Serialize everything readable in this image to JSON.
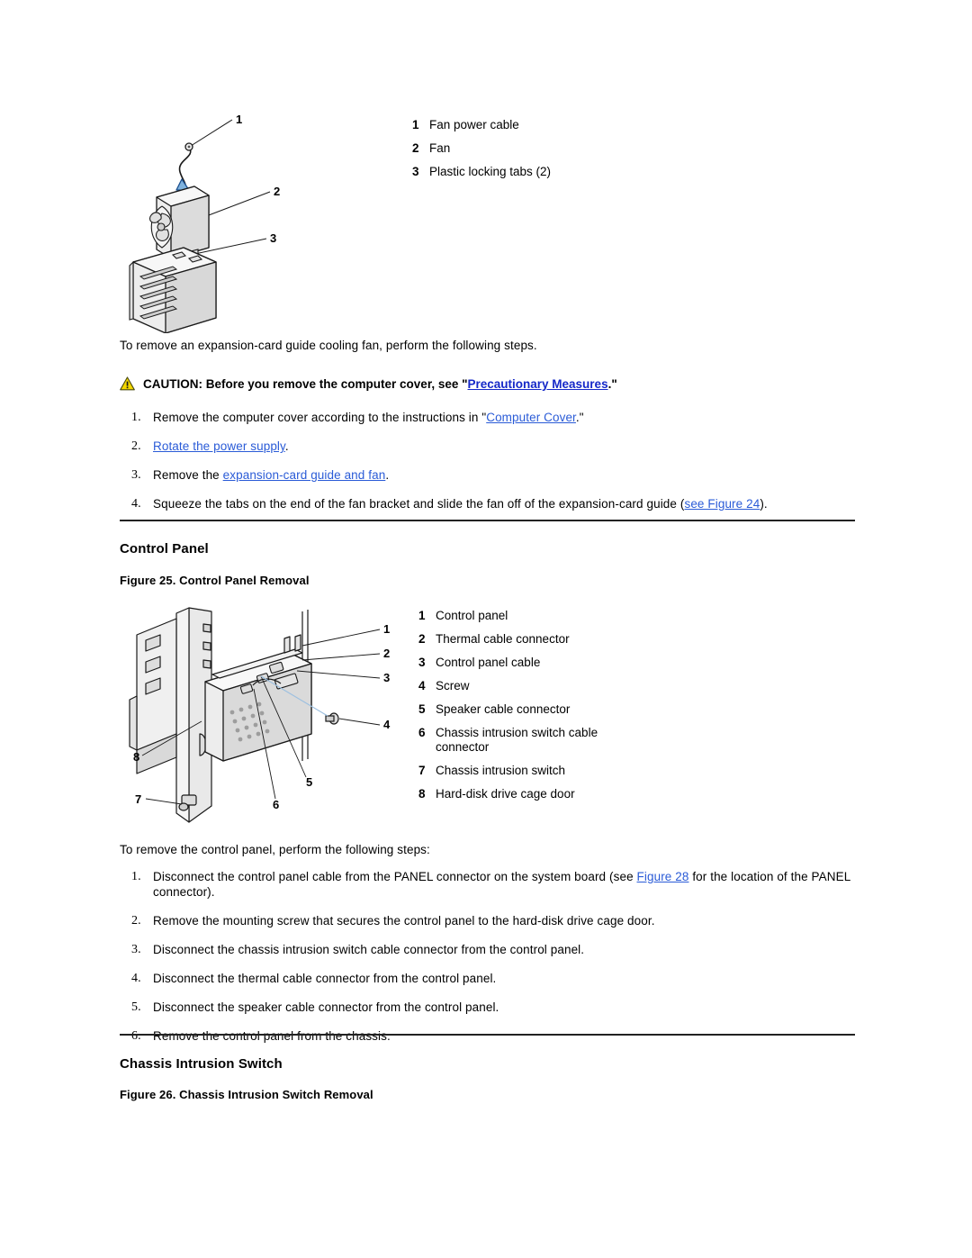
{
  "figure_fan": {
    "legend": [
      {
        "num": "1",
        "label": "Fan power cable"
      },
      {
        "num": "2",
        "label": "Fan"
      },
      {
        "num": "3",
        "label": "Plastic locking tabs (2)"
      }
    ],
    "art_callouts": [
      "1",
      "2",
      "3"
    ]
  },
  "fan_section": {
    "intro": "To remove an expansion-card guide cooling fan, perform the following steps.",
    "caution": {
      "icon": "warning-triangle-icon",
      "prefix": "CAUTION: Before you remove the computer cover, see \"",
      "link": "Precautionary Measures",
      "suffix": ".\""
    },
    "steps": [
      {
        "parts": [
          {
            "type": "text",
            "text": "Remove the computer cover according to the instructions in \""
          },
          {
            "type": "link",
            "text": "Computer Cover"
          },
          {
            "type": "text",
            "text": ".\""
          }
        ]
      },
      {
        "parts": [
          {
            "type": "link",
            "text": "Rotate the power supply"
          },
          {
            "type": "text",
            "text": "."
          }
        ]
      },
      {
        "parts": [
          {
            "type": "text",
            "text": "Remove the "
          },
          {
            "type": "link",
            "text": "expansion-card guide and fan"
          },
          {
            "type": "text",
            "text": "."
          }
        ]
      },
      {
        "parts": [
          {
            "type": "text",
            "text": "Squeeze the tabs on the end of the fan bracket and slide the fan off of the expansion-card guide ("
          },
          {
            "type": "link",
            "text": "see Figure 24"
          },
          {
            "type": "text",
            "text": ")."
          }
        ]
      }
    ]
  },
  "control_panel_section": {
    "title": "Control Panel",
    "figure_caption": "Figure 25. Control Panel Removal",
    "legend": [
      {
        "num": "1",
        "label": "Control panel"
      },
      {
        "num": "2",
        "label": "Thermal cable connector"
      },
      {
        "num": "3",
        "label": "Control panel cable"
      },
      {
        "num": "4",
        "label": "Screw"
      },
      {
        "num": "5",
        "label": "Speaker cable connector"
      },
      {
        "num": "6",
        "label": "Chassis intrusion switch cable connector"
      },
      {
        "num": "7",
        "label": "Chassis intrusion switch"
      },
      {
        "num": "8",
        "label": "Hard-disk drive cage door"
      }
    ],
    "art_callouts": [
      "1",
      "2",
      "3",
      "4",
      "5",
      "6",
      "7",
      "8"
    ],
    "intro": "To remove the control panel, perform the following steps:",
    "steps": [
      {
        "parts": [
          {
            "type": "text",
            "text": "Disconnect the control panel cable from the PANEL connector on the system board (see "
          },
          {
            "type": "link",
            "text": "Figure 28"
          },
          {
            "type": "text",
            "text": " for the location of the PANEL connector)."
          }
        ]
      },
      {
        "parts": [
          {
            "type": "text",
            "text": "Remove the mounting screw that secures the control panel to the hard-disk drive cage door."
          }
        ]
      },
      {
        "parts": [
          {
            "type": "text",
            "text": "Disconnect the chassis intrusion switch cable connector from the control panel."
          }
        ]
      },
      {
        "parts": [
          {
            "type": "text",
            "text": "Disconnect the thermal cable connector from the control panel."
          }
        ]
      },
      {
        "parts": [
          {
            "type": "text",
            "text": "Disconnect the speaker cable connector from the control panel."
          }
        ]
      },
      {
        "parts": [
          {
            "type": "text",
            "text": "Remove the control panel from the chassis."
          }
        ]
      }
    ]
  },
  "chassis_intrusion_section": {
    "title": "Chassis Intrusion Switch",
    "figure_caption": "Figure 26. Chassis Intrusion Switch Removal"
  },
  "colors": {
    "link": "#2a5bd7",
    "caution_link": "#1528c8",
    "rule": "#222222",
    "warning_fill": "#f5d800",
    "arrow_fill": "#7fb2dd",
    "arrow_stroke": "#1b4f8f",
    "art_fill": "#e8e8e8",
    "art_stroke": "#1a1a1a"
  }
}
